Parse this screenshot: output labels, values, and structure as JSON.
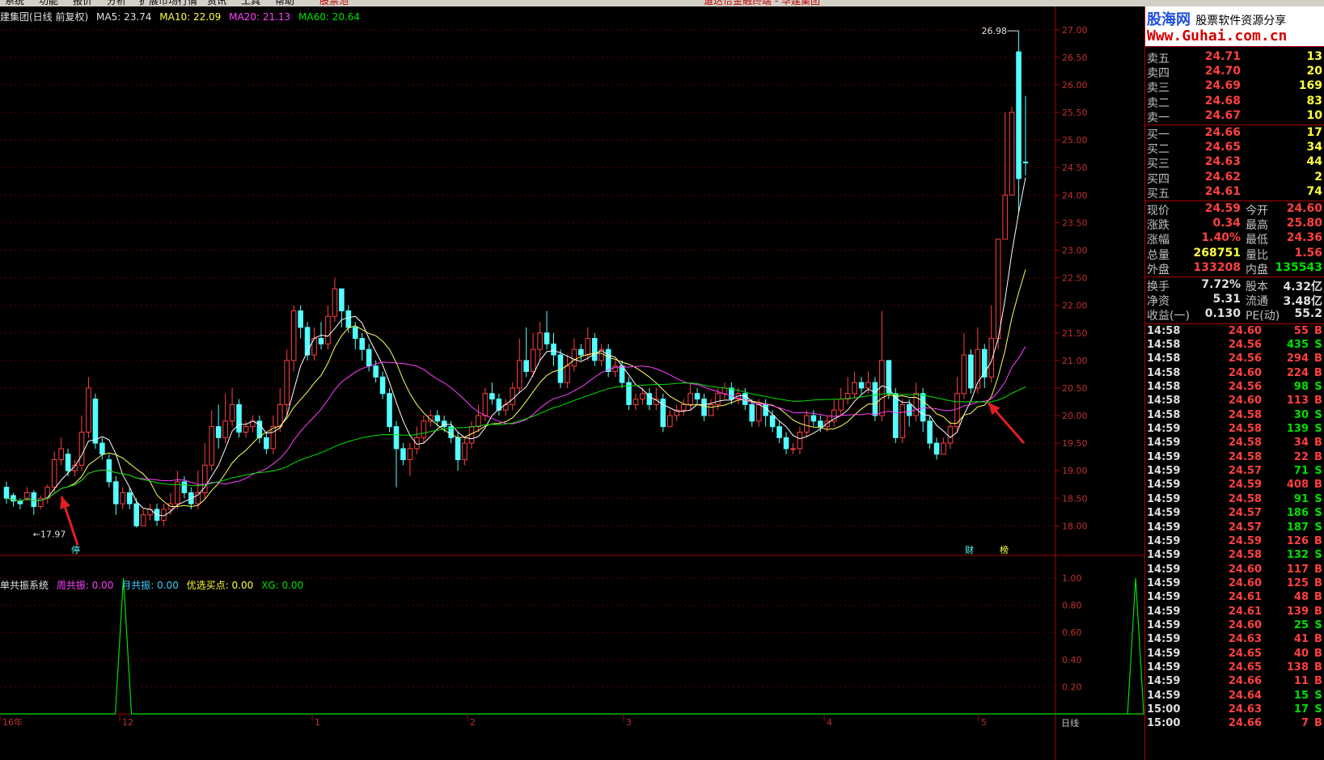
{
  "menu": [
    "系统",
    "功能",
    "报价",
    "分析",
    "扩展市场行情",
    "资讯",
    "工具",
    "帮助",
    "股票池"
  ],
  "header_notice": "道达恰金融终端 - 华建集团",
  "legend": {
    "title": "建集团(日线 前复权)",
    "ma5": "MA5: 23.74",
    "ma10": "MA10: 22.09",
    "ma20": "MA20: 21.13",
    "ma60": "MA60: 20.64"
  },
  "indicator_legend": {
    "title": "单共振系统",
    "weekly": "周共振: 0.00",
    "monthly": "月共振: 0.00",
    "buy": "优选买点: 0.00",
    "xg": "XG: 0.00"
  },
  "price_axis": [
    "27.00",
    "26.50",
    "26.00",
    "25.50",
    "25.00",
    "24.50",
    "24.00",
    "23.50",
    "23.00",
    "22.50",
    "22.00",
    "21.50",
    "21.00",
    "20.50",
    "20.00",
    "19.50",
    "19.00",
    "18.50",
    "18.00"
  ],
  "ind_axis": [
    "1.00",
    "0.80",
    "0.60",
    "0.40",
    "0.20"
  ],
  "date_labels": [
    "16年",
    "12",
    "1",
    "2",
    "3",
    "4",
    "5"
  ],
  "period_label": "日线",
  "annotations": {
    "high": "26.98",
    "low": "17.97",
    "tag_stop": "停",
    "tag_cai": "财",
    "tag_bang": "榜"
  },
  "logo": {
    "site": "股海网",
    "slogan": "股票软件资源分享",
    "url": "Www.Guhai.com.cn"
  },
  "order_book": {
    "asks": [
      {
        "label": "卖五",
        "price": "24.71",
        "vol": "13"
      },
      {
        "label": "卖四",
        "price": "24.70",
        "vol": "20"
      },
      {
        "label": "卖三",
        "price": "24.69",
        "vol": "169"
      },
      {
        "label": "卖二",
        "price": "24.68",
        "vol": "83"
      },
      {
        "label": "卖一",
        "price": "24.67",
        "vol": "10"
      }
    ],
    "bids": [
      {
        "label": "买一",
        "price": "24.66",
        "vol": "17"
      },
      {
        "label": "买二",
        "price": "24.65",
        "vol": "34"
      },
      {
        "label": "买三",
        "price": "24.63",
        "vol": "44"
      },
      {
        "label": "买四",
        "price": "24.62",
        "vol": "2"
      },
      {
        "label": "买五",
        "price": "24.61",
        "vol": "74"
      }
    ]
  },
  "quote": [
    {
      "l1": "现价",
      "v1": "24.59",
      "c1": "red",
      "l2": "今开",
      "v2": "24.60",
      "c2": "red"
    },
    {
      "l1": "涨跌",
      "v1": "0.34",
      "c1": "red",
      "l2": "最高",
      "v2": "25.80",
      "c2": "red"
    },
    {
      "l1": "涨幅",
      "v1": "1.40%",
      "c1": "red",
      "l2": "最低",
      "v2": "24.36",
      "c2": "red"
    },
    {
      "l1": "总量",
      "v1": "268751",
      "c1": "yellow",
      "l2": "量比",
      "v2": "1.56",
      "c2": "red"
    },
    {
      "l1": "外盘",
      "v1": "133208",
      "c1": "red",
      "l2": "内盘",
      "v2": "135543",
      "c2": "green"
    }
  ],
  "fundamentals": [
    {
      "l1": "换手",
      "v1": "7.72%",
      "l2": "股本",
      "v2": "4.32亿"
    },
    {
      "l1": "净资",
      "v1": "5.31",
      "l2": "流通",
      "v2": "3.48亿"
    },
    {
      "l1": "收益(一)",
      "v1": "0.130",
      "l2": "PE(动)",
      "v2": "55.2"
    }
  ],
  "trades": [
    {
      "t": "14:58",
      "p": "24.60",
      "v": "55",
      "s": "B"
    },
    {
      "t": "14:58",
      "p": "24.56",
      "v": "435",
      "s": "S"
    },
    {
      "t": "14:58",
      "p": "24.56",
      "v": "294",
      "s": "B"
    },
    {
      "t": "14:58",
      "p": "24.60",
      "v": "224",
      "s": "B"
    },
    {
      "t": "14:58",
      "p": "24.56",
      "v": "98",
      "s": "S"
    },
    {
      "t": "14:58",
      "p": "24.60",
      "v": "113",
      "s": "B"
    },
    {
      "t": "14:58",
      "p": "24.58",
      "v": "30",
      "s": "S"
    },
    {
      "t": "14:59",
      "p": "24.58",
      "v": "139",
      "s": "S"
    },
    {
      "t": "14:59",
      "p": "24.58",
      "v": "34",
      "s": "B"
    },
    {
      "t": "14:59",
      "p": "24.58",
      "v": "22",
      "s": "B"
    },
    {
      "t": "14:59",
      "p": "24.57",
      "v": "71",
      "s": "S"
    },
    {
      "t": "14:59",
      "p": "24.59",
      "v": "408",
      "s": "B"
    },
    {
      "t": "14:59",
      "p": "24.58",
      "v": "91",
      "s": "S"
    },
    {
      "t": "14:59",
      "p": "24.57",
      "v": "186",
      "s": "S"
    },
    {
      "t": "14:59",
      "p": "24.57",
      "v": "187",
      "s": "S"
    },
    {
      "t": "14:59",
      "p": "24.59",
      "v": "126",
      "s": "B"
    },
    {
      "t": "14:59",
      "p": "24.58",
      "v": "132",
      "s": "S"
    },
    {
      "t": "14:59",
      "p": "24.60",
      "v": "117",
      "s": "B"
    },
    {
      "t": "14:59",
      "p": "24.60",
      "v": "125",
      "s": "B"
    },
    {
      "t": "14:59",
      "p": "24.61",
      "v": "48",
      "s": "B"
    },
    {
      "t": "14:59",
      "p": "24.61",
      "v": "139",
      "s": "B"
    },
    {
      "t": "14:59",
      "p": "24.60",
      "v": "25",
      "s": "S"
    },
    {
      "t": "14:59",
      "p": "24.63",
      "v": "41",
      "s": "B"
    },
    {
      "t": "14:59",
      "p": "24.65",
      "v": "40",
      "s": "B"
    },
    {
      "t": "14:59",
      "p": "24.65",
      "v": "138",
      "s": "B"
    },
    {
      "t": "14:59",
      "p": "24.66",
      "v": "11",
      "s": "B"
    },
    {
      "t": "14:59",
      "p": "24.64",
      "v": "15",
      "s": "S"
    },
    {
      "t": "15:00",
      "p": "24.63",
      "v": "17",
      "s": "S"
    },
    {
      "t": "15:00",
      "p": "24.66",
      "v": "7",
      "s": "B"
    }
  ],
  "colors": {
    "up": "#ff4040",
    "down": "#54ffff",
    "ma5": "#ffffff",
    "ma10": "#ffff60",
    "ma20": "#ff40ff",
    "ma60": "#00e000",
    "border": "#aa0000"
  },
  "chart_data": {
    "type": "candlestick",
    "ylim": [
      17.8,
      27.1
    ],
    "candles": [
      [
        18.7,
        18.5,
        18.8,
        18.4
      ],
      [
        18.55,
        18.45,
        18.6,
        18.35
      ],
      [
        18.45,
        18.4,
        18.5,
        18.3
      ],
      [
        18.5,
        18.6,
        18.7,
        18.45
      ],
      [
        18.6,
        18.35,
        18.65,
        18.2
      ],
      [
        18.35,
        18.5,
        18.55,
        18.3
      ],
      [
        18.5,
        18.7,
        18.75,
        18.4
      ],
      [
        18.7,
        19.2,
        19.35,
        18.6
      ],
      [
        19.2,
        19.4,
        19.6,
        19.1
      ],
      [
        19.3,
        19.0,
        19.4,
        18.9
      ],
      [
        19.0,
        19.1,
        19.2,
        18.9
      ],
      [
        19.1,
        19.7,
        20.0,
        19.0
      ],
      [
        19.7,
        20.5,
        20.7,
        19.6
      ],
      [
        20.3,
        19.5,
        20.4,
        19.4
      ],
      [
        19.5,
        19.3,
        19.6,
        19.2
      ],
      [
        19.2,
        18.8,
        19.3,
        18.7
      ],
      [
        18.8,
        18.4,
        18.9,
        18.2
      ],
      [
        18.4,
        18.6,
        18.7,
        18.3
      ],
      [
        18.6,
        18.4,
        18.7,
        18.3
      ],
      [
        18.4,
        18.0,
        18.5,
        17.97
      ],
      [
        18.0,
        18.2,
        18.3,
        18.0
      ],
      [
        18.2,
        18.3,
        18.4,
        18.1
      ],
      [
        18.3,
        18.1,
        18.4,
        18.0
      ],
      [
        18.1,
        18.3,
        18.4,
        18.0
      ],
      [
        18.3,
        18.4,
        18.6,
        18.2
      ],
      [
        18.4,
        18.8,
        19.0,
        18.3
      ],
      [
        18.8,
        18.6,
        18.9,
        18.5
      ],
      [
        18.6,
        18.4,
        18.7,
        18.3
      ],
      [
        18.4,
        18.6,
        19.0,
        18.3
      ],
      [
        18.6,
        19.1,
        19.5,
        18.5
      ],
      [
        19.1,
        19.8,
        20.1,
        19.0
      ],
      [
        19.8,
        19.6,
        20.2,
        19.4
      ],
      [
        19.6,
        19.9,
        20.4,
        19.5
      ],
      [
        19.9,
        20.2,
        20.5,
        19.8
      ],
      [
        20.2,
        19.7,
        20.3,
        19.6
      ],
      [
        19.7,
        19.8,
        19.9,
        19.6
      ],
      [
        19.8,
        19.9,
        20.0,
        19.7
      ],
      [
        19.9,
        19.6,
        20.0,
        19.5
      ],
      [
        19.6,
        19.4,
        19.7,
        19.3
      ],
      [
        19.4,
        19.8,
        20.0,
        19.3
      ],
      [
        19.8,
        20.2,
        20.5,
        19.7
      ],
      [
        20.2,
        21.0,
        21.2,
        20.0
      ],
      [
        21.0,
        21.9,
        22.0,
        20.8
      ],
      [
        21.9,
        21.6,
        22.0,
        21.4
      ],
      [
        21.6,
        21.1,
        21.7,
        21.0
      ],
      [
        21.1,
        21.4,
        21.6,
        21.0
      ],
      [
        21.4,
        21.3,
        21.7,
        21.2
      ],
      [
        21.3,
        21.8,
        22.0,
        21.2
      ],
      [
        21.8,
        22.3,
        22.5,
        21.7
      ],
      [
        22.3,
        21.9,
        22.3,
        21.6
      ],
      [
        21.9,
        21.6,
        22.0,
        21.5
      ],
      [
        21.6,
        21.4,
        21.7,
        21.2
      ],
      [
        21.4,
        21.2,
        21.5,
        21.0
      ],
      [
        21.2,
        20.9,
        21.3,
        20.8
      ],
      [
        20.9,
        20.7,
        21.0,
        20.6
      ],
      [
        20.7,
        20.4,
        20.8,
        20.3
      ],
      [
        20.4,
        19.8,
        20.5,
        19.7
      ],
      [
        19.8,
        19.4,
        19.9,
        18.7
      ],
      [
        19.4,
        19.2,
        19.5,
        19.1
      ],
      [
        19.2,
        19.4,
        19.5,
        18.9
      ],
      [
        19.4,
        19.6,
        19.8,
        19.3
      ],
      [
        19.6,
        19.9,
        20.0,
        19.5
      ],
      [
        19.9,
        20.0,
        20.1,
        19.8
      ],
      [
        20.0,
        19.9,
        20.1,
        19.8
      ],
      [
        19.9,
        19.8,
        20.0,
        19.7
      ],
      [
        19.8,
        19.6,
        19.9,
        19.5
      ],
      [
        19.6,
        19.2,
        19.7,
        19.0
      ],
      [
        19.2,
        19.5,
        19.6,
        19.1
      ],
      [
        19.5,
        19.8,
        19.9,
        19.4
      ],
      [
        19.8,
        20.0,
        20.2,
        19.7
      ],
      [
        20.0,
        20.4,
        20.5,
        19.9
      ],
      [
        20.4,
        20.3,
        20.6,
        20.2
      ],
      [
        20.3,
        20.1,
        20.4,
        20.0
      ],
      [
        20.1,
        20.2,
        20.3,
        20.0
      ],
      [
        20.2,
        20.5,
        20.6,
        20.1
      ],
      [
        20.5,
        21.0,
        21.4,
        20.4
      ],
      [
        21.0,
        20.8,
        21.6,
        20.7
      ],
      [
        20.8,
        21.2,
        21.5,
        20.7
      ],
      [
        21.2,
        21.5,
        21.7,
        21.0
      ],
      [
        21.5,
        21.3,
        21.9,
        21.2
      ],
      [
        21.3,
        21.1,
        21.5,
        20.9
      ],
      [
        21.1,
        20.6,
        21.2,
        20.5
      ],
      [
        20.6,
        20.9,
        21.1,
        20.5
      ],
      [
        20.9,
        21.2,
        21.4,
        20.8
      ],
      [
        21.2,
        21.1,
        21.3,
        21.0
      ],
      [
        21.1,
        21.4,
        21.6,
        21.0
      ],
      [
        21.4,
        21.0,
        21.5,
        20.9
      ],
      [
        21.0,
        21.2,
        21.3,
        20.9
      ],
      [
        21.2,
        20.8,
        21.3,
        20.7
      ],
      [
        20.8,
        20.9,
        21.0,
        20.7
      ],
      [
        20.9,
        20.6,
        21.0,
        20.5
      ],
      [
        20.6,
        20.2,
        20.7,
        20.1
      ],
      [
        20.2,
        20.3,
        20.4,
        20.1
      ],
      [
        20.3,
        20.4,
        20.5,
        20.2
      ],
      [
        20.4,
        20.2,
        20.5,
        20.1
      ],
      [
        20.2,
        20.3,
        20.5,
        20.1
      ],
      [
        20.3,
        19.8,
        20.4,
        19.7
      ],
      [
        19.8,
        20.0,
        20.1,
        19.8
      ],
      [
        20.0,
        20.1,
        20.2,
        19.9
      ],
      [
        20.1,
        20.2,
        20.3,
        20.0
      ],
      [
        20.2,
        20.4,
        20.6,
        20.1
      ],
      [
        20.4,
        20.3,
        20.5,
        20.2
      ],
      [
        20.3,
        20.0,
        20.4,
        19.9
      ],
      [
        20.0,
        20.2,
        20.3,
        20.0
      ],
      [
        20.2,
        20.4,
        20.5,
        20.1
      ],
      [
        20.4,
        20.5,
        20.6,
        20.3
      ],
      [
        20.5,
        20.3,
        20.6,
        20.2
      ],
      [
        20.3,
        20.4,
        20.5,
        20.2
      ],
      [
        20.4,
        20.2,
        20.5,
        20.1
      ],
      [
        20.2,
        19.9,
        20.3,
        19.8
      ],
      [
        19.9,
        20.2,
        20.3,
        19.8
      ],
      [
        20.2,
        20.0,
        20.3,
        19.8
      ],
      [
        20.0,
        19.8,
        20.1,
        19.7
      ],
      [
        19.8,
        19.6,
        19.9,
        19.5
      ],
      [
        19.6,
        19.4,
        19.7,
        19.3
      ],
      [
        19.4,
        19.4,
        19.5,
        19.3
      ],
      [
        19.4,
        19.7,
        19.8,
        19.3
      ],
      [
        19.7,
        20.0,
        20.1,
        19.6
      ],
      [
        20.0,
        19.9,
        20.1,
        19.8
      ],
      [
        19.9,
        19.8,
        20.0,
        19.7
      ],
      [
        19.8,
        19.9,
        20.0,
        19.7
      ],
      [
        19.9,
        20.1,
        20.3,
        19.8
      ],
      [
        20.1,
        20.3,
        20.5,
        20.0
      ],
      [
        20.3,
        20.4,
        20.7,
        20.2
      ],
      [
        20.4,
        20.6,
        20.8,
        20.3
      ],
      [
        20.6,
        20.5,
        20.7,
        20.4
      ],
      [
        20.5,
        20.6,
        20.8,
        20.4
      ],
      [
        20.6,
        20.0,
        20.7,
        19.9
      ],
      [
        20.0,
        21.0,
        21.9,
        19.9
      ],
      [
        21.0,
        20.4,
        21.0,
        20.3
      ],
      [
        20.4,
        19.6,
        20.5,
        19.5
      ],
      [
        19.6,
        20.2,
        20.3,
        19.5
      ],
      [
        20.2,
        20.0,
        20.3,
        19.8
      ],
      [
        20.0,
        20.4,
        20.6,
        19.9
      ],
      [
        20.4,
        19.9,
        20.5,
        19.7
      ],
      [
        19.9,
        19.5,
        20.0,
        19.4
      ],
      [
        19.5,
        19.3,
        19.6,
        19.2
      ],
      [
        19.3,
        19.5,
        19.6,
        19.3
      ],
      [
        19.5,
        19.8,
        19.9,
        19.4
      ],
      [
        19.8,
        20.4,
        20.7,
        19.7
      ],
      [
        20.4,
        21.1,
        21.5,
        20.3
      ],
      [
        21.1,
        20.5,
        21.2,
        20.4
      ],
      [
        20.5,
        21.2,
        21.6,
        20.4
      ],
      [
        21.2,
        20.7,
        21.3,
        20.5
      ],
      [
        20.7,
        21.4,
        22.0,
        20.6
      ],
      [
        21.4,
        23.2,
        23.2,
        21.2
      ],
      [
        23.2,
        24.0,
        25.5,
        23.9
      ],
      [
        24.0,
        25.5,
        25.6,
        24.0
      ],
      [
        26.6,
        24.3,
        26.98,
        23.7
      ],
      [
        24.6,
        24.59,
        25.8,
        24.36
      ]
    ],
    "signals": {
      "weekly_resonance_peaks": [
        10,
        158
      ]
    }
  }
}
